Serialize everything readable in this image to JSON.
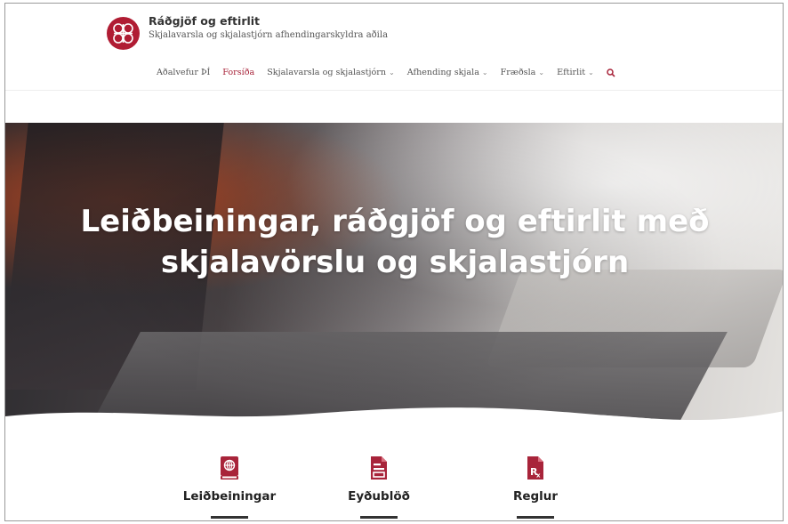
{
  "brand": {
    "title": "Ráðgjöf og eftirlit",
    "subtitle": "Skjalavarsla og skjalastjórn afhendingarskyldra aðila"
  },
  "nav": {
    "items": [
      {
        "label": "Aðalvefur ÞÍ",
        "dropdown": false,
        "active": false
      },
      {
        "label": "Forsíða",
        "dropdown": false,
        "active": true
      },
      {
        "label": "Skjalavarsla og skjalastjórn",
        "dropdown": true,
        "active": false
      },
      {
        "label": "Afhending skjala",
        "dropdown": true,
        "active": false
      },
      {
        "label": "Fræðsla",
        "dropdown": true,
        "active": false
      },
      {
        "label": "Eftirlit",
        "dropdown": true,
        "active": false
      }
    ],
    "search_icon": "search-icon"
  },
  "hero": {
    "title": "Leiðbeiningar, ráðgjöf og eftirlit með skjalavörslu og skjalastjórn"
  },
  "features": [
    {
      "label": "Leiðbeiningar",
      "icon": "book-globe-icon"
    },
    {
      "label": "Eyðublöð",
      "icon": "form-document-icon"
    },
    {
      "label": "Reglur",
      "icon": "rx-document-icon"
    }
  ],
  "colors": {
    "accent": "#a8243a",
    "logo": "#b01c33"
  }
}
